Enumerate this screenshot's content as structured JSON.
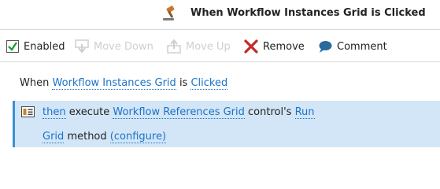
{
  "title": "When Workflow Instances Grid is Clicked",
  "toolbar": {
    "enabled": "Enabled",
    "enabled_checked": true,
    "move_down": "Move Down",
    "move_up": "Move Up",
    "remove": "Remove",
    "comment": "Comment"
  },
  "rule": {
    "when": "When",
    "control": "Workflow Instances Grid",
    "is": "is",
    "event": "Clicked"
  },
  "action": {
    "then": "then",
    "execute": "execute",
    "control": "Workflow References Grid",
    "controls": "control's",
    "method_part1": "Run",
    "method_part2": "Grid",
    "method_word": "method",
    "configure": "(configure)"
  },
  "colors": {
    "accent": "#1a73c8",
    "action_bg": "#d3e6f7",
    "remove_red": "#c62828",
    "comment_blue": "#2a6b9e"
  }
}
